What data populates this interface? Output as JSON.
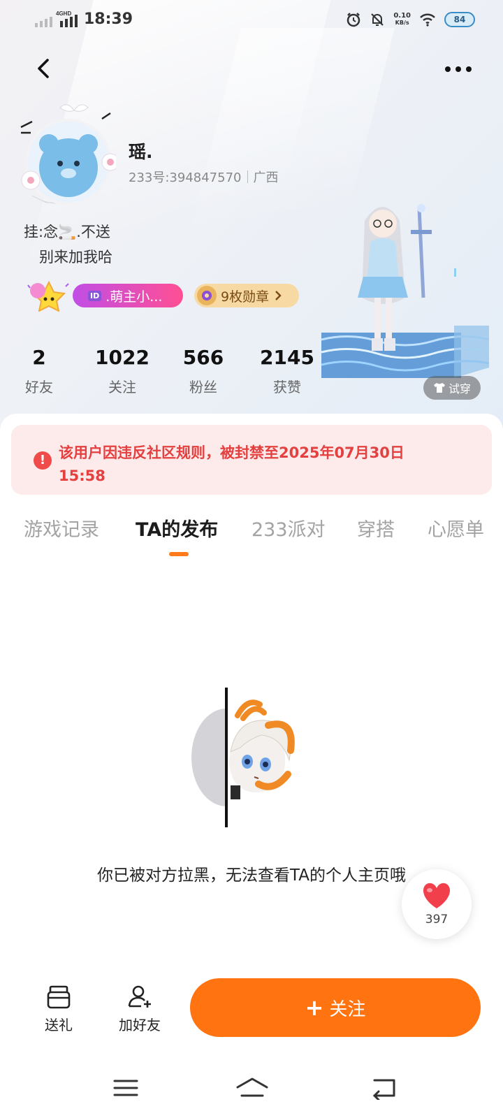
{
  "status_bar": {
    "time": "18:39",
    "network_label": "4GHD",
    "speed_value": "0.10",
    "speed_unit": "KB/s",
    "battery": "84"
  },
  "header": {
    "back_icon": "chevron-left-icon",
    "more_icon": "more-horizontal-icon"
  },
  "profile": {
    "nickname": "瑶.",
    "id_text": "233号:394847570",
    "region": "广西",
    "signature_line1": "挂:念🚬.不送",
    "signature_line2": "别来加我哈",
    "title_badge_tag": "ID",
    "title_badge_text": ".萌主小...",
    "medal_text": "9枚勋章"
  },
  "stats": [
    {
      "value": "2",
      "label": "好友"
    },
    {
      "value": "1022",
      "label": "关注"
    },
    {
      "value": "566",
      "label": "粉丝"
    },
    {
      "value": "2145",
      "label": "获赞"
    }
  ],
  "try_on_label": "试穿",
  "ban_notice": {
    "text": "该用户因违反社区规则，被封禁至2025年07月30日 15:58",
    "color": "#e44040"
  },
  "tabs": [
    {
      "label": "游戏记录",
      "active": false
    },
    {
      "label": "TA的发布",
      "active": true
    },
    {
      "label": "233派对",
      "active": false
    },
    {
      "label": "穿搭",
      "active": false
    },
    {
      "label": "心愿单",
      "active": false
    }
  ],
  "empty_state": {
    "message": "你已被对方拉黑，无法查看TA的个人主页哦"
  },
  "like_count": "397",
  "bottom_bar": {
    "gift_label": "送礼",
    "add_friend_label": "加好友",
    "follow_label": "关注",
    "accent_color": "#ff7410"
  }
}
